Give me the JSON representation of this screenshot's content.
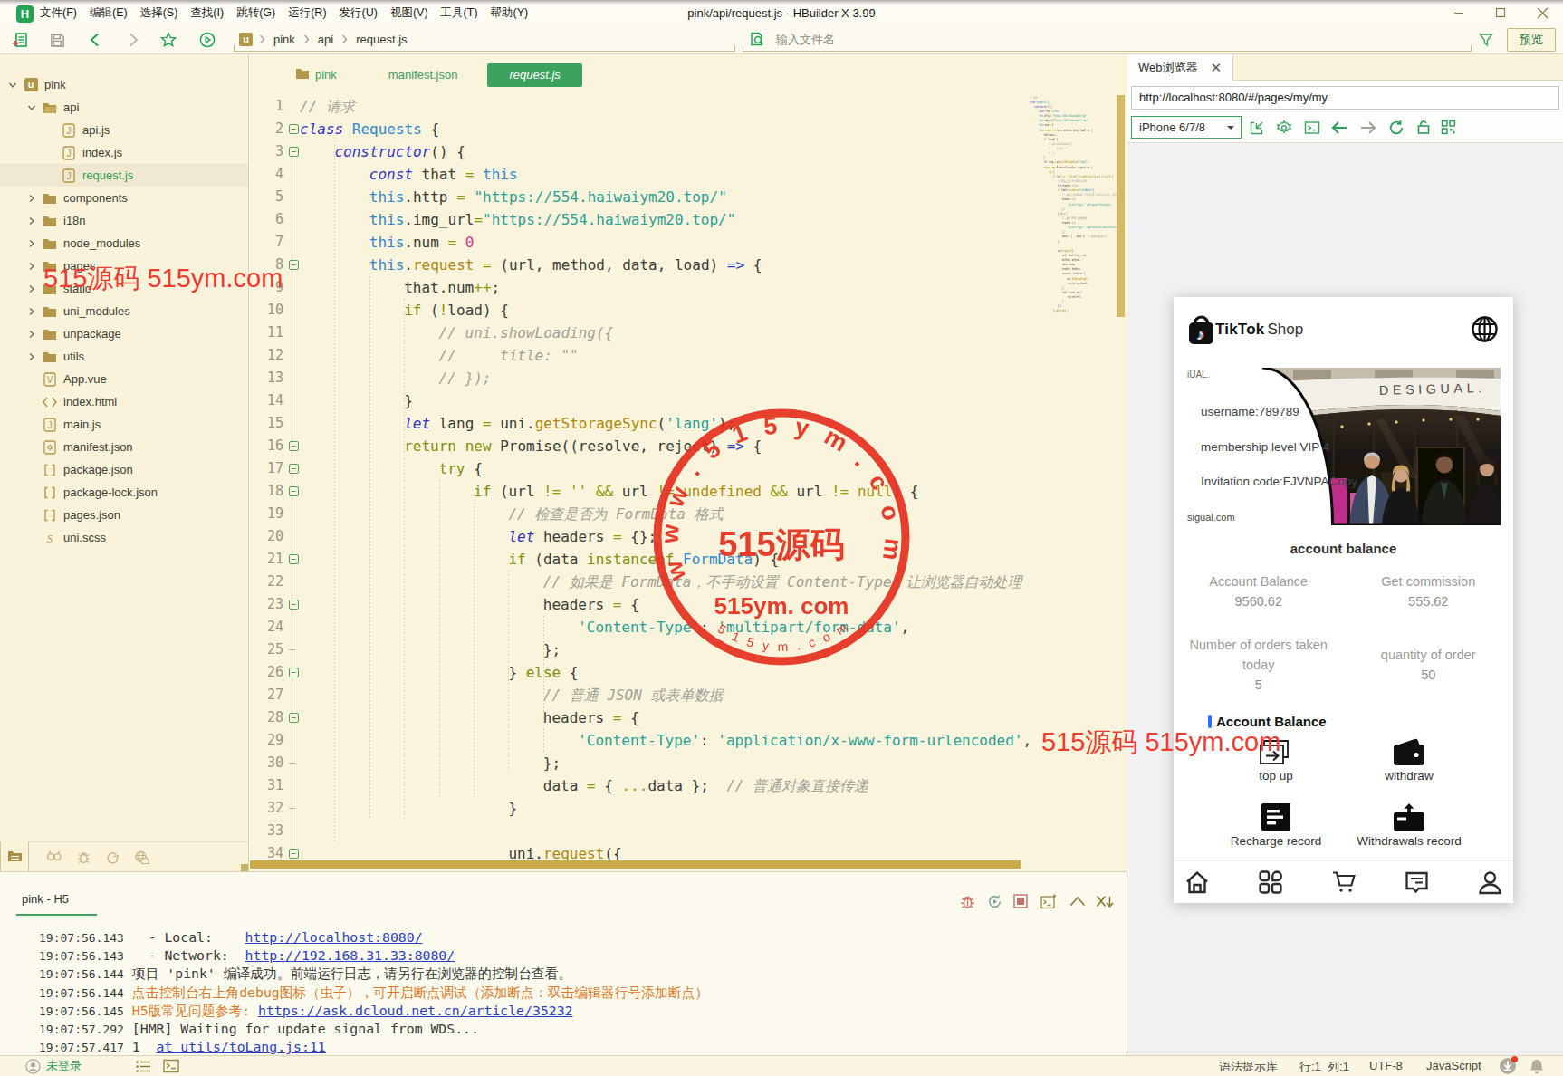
{
  "window": {
    "title": "pink/api/request.js - HBuilder X 3.99",
    "logo_letter": "H",
    "menus": [
      "文件(F)",
      "编辑(E)",
      "选择(S)",
      "查找(I)",
      "跳转(G)",
      "运行(R)",
      "发行(U)",
      "视图(V)",
      "工具(T)",
      "帮助(Y)"
    ]
  },
  "toolbar": {
    "breadcrumb": [
      "pink",
      "api",
      "request.js"
    ],
    "breadcrumb_icon": "u",
    "search_placeholder": "输入文件名",
    "preview_label": "预览"
  },
  "sidebar": {
    "tree": [
      {
        "label": "pink",
        "depth": 0,
        "kind": "project",
        "chev": "down"
      },
      {
        "label": "api",
        "depth": 1,
        "kind": "folder-open",
        "chev": "down"
      },
      {
        "label": "api.js",
        "depth": 2,
        "kind": "js"
      },
      {
        "label": "index.js",
        "depth": 2,
        "kind": "js"
      },
      {
        "label": "request.js",
        "depth": 2,
        "kind": "js",
        "selected": true
      },
      {
        "label": "components",
        "depth": 1,
        "kind": "folder",
        "chev": "right"
      },
      {
        "label": "i18n",
        "depth": 1,
        "kind": "folder",
        "chev": "right"
      },
      {
        "label": "node_modules",
        "depth": 1,
        "kind": "folder",
        "chev": "right"
      },
      {
        "label": "pages",
        "depth": 1,
        "kind": "folder",
        "chev": "right"
      },
      {
        "label": "static",
        "depth": 1,
        "kind": "folder",
        "chev": "right"
      },
      {
        "label": "uni_modules",
        "depth": 1,
        "kind": "folder",
        "chev": "right"
      },
      {
        "label": "unpackage",
        "depth": 1,
        "kind": "folder",
        "chev": "right"
      },
      {
        "label": "utils",
        "depth": 1,
        "kind": "folder",
        "chev": "right"
      },
      {
        "label": "App.vue",
        "depth": 1,
        "kind": "vue"
      },
      {
        "label": "index.html",
        "depth": 1,
        "kind": "html"
      },
      {
        "label": "main.js",
        "depth": 1,
        "kind": "js"
      },
      {
        "label": "manifest.json",
        "depth": 1,
        "kind": "json-gear"
      },
      {
        "label": "package.json",
        "depth": 1,
        "kind": "json-br"
      },
      {
        "label": "package-lock.json",
        "depth": 1,
        "kind": "json-br"
      },
      {
        "label": "pages.json",
        "depth": 1,
        "kind": "json-br"
      },
      {
        "label": "uni.scss",
        "depth": 1,
        "kind": "scss"
      }
    ]
  },
  "editor": {
    "tabs": [
      {
        "label": "pink",
        "icon": "folder",
        "active": false
      },
      {
        "label": "manifest.json",
        "active": false
      },
      {
        "label": "request.js",
        "active": true
      }
    ],
    "fold_lines": [
      2,
      3,
      8,
      16,
      17,
      18,
      21,
      23,
      26,
      28,
      34
    ],
    "fold_end_lines": [
      25,
      30,
      32
    ],
    "code_lines": [
      {
        "n": 1,
        "ind": 0,
        "t": [
          [
            "cm",
            "// 请求"
          ]
        ]
      },
      {
        "n": 2,
        "ind": 0,
        "t": [
          [
            "kw",
            "class"
          ],
          [
            "pl",
            " "
          ],
          [
            "az",
            "Requests"
          ],
          [
            "pl",
            " {"
          ]
        ]
      },
      {
        "n": 3,
        "ind": 4,
        "t": [
          [
            "kw",
            "constructor"
          ],
          [
            "pl",
            "() {"
          ]
        ]
      },
      {
        "n": 4,
        "ind": 8,
        "t": [
          [
            "kw",
            "const"
          ],
          [
            "pl",
            " that "
          ],
          [
            "op",
            "="
          ],
          [
            "pl",
            " "
          ],
          [
            "az",
            "this"
          ]
        ]
      },
      {
        "n": 5,
        "ind": 8,
        "t": [
          [
            "az",
            "this"
          ],
          [
            "pl",
            ".http "
          ],
          [
            "op",
            "="
          ],
          [
            "pl",
            " "
          ],
          [
            "st",
            "\"https://554.haiwaiym20.top/\""
          ]
        ]
      },
      {
        "n": 6,
        "ind": 8,
        "t": [
          [
            "az",
            "this"
          ],
          [
            "pl",
            ".img_url"
          ],
          [
            "op",
            "="
          ],
          [
            "st",
            "\"https://554.haiwaiym20.top/\""
          ]
        ]
      },
      {
        "n": 7,
        "ind": 8,
        "t": [
          [
            "az",
            "this"
          ],
          [
            "pl",
            ".num "
          ],
          [
            "op",
            "="
          ],
          [
            "pl",
            " "
          ],
          [
            "nu",
            "0"
          ]
        ]
      },
      {
        "n": 8,
        "ind": 8,
        "t": [
          [
            "az",
            "this"
          ],
          [
            "pl",
            "."
          ],
          [
            "pr",
            "request"
          ],
          [
            "pl",
            " "
          ],
          [
            "op",
            "="
          ],
          [
            "pl",
            " (url, method, data, load) "
          ],
          [
            "ar",
            "=>"
          ],
          [
            "pl",
            " {"
          ]
        ]
      },
      {
        "n": 9,
        "ind": 12,
        "t": [
          [
            "pl",
            "that.num"
          ],
          [
            "op",
            "++"
          ],
          [
            "pl",
            ";"
          ]
        ]
      },
      {
        "n": 10,
        "ind": 12,
        "t": [
          [
            "ct",
            "if"
          ],
          [
            "pl",
            " ("
          ],
          [
            "op",
            "!"
          ],
          [
            "pl",
            "load) {"
          ]
        ]
      },
      {
        "n": 11,
        "ind": 16,
        "t": [
          [
            "cm",
            "// uni.showLoading({"
          ]
        ]
      },
      {
        "n": 12,
        "ind": 16,
        "t": [
          [
            "cm",
            "//     title: \"\""
          ]
        ]
      },
      {
        "n": 13,
        "ind": 16,
        "t": [
          [
            "cm",
            "// });"
          ]
        ]
      },
      {
        "n": 14,
        "ind": 12,
        "t": [
          [
            "pl",
            "}"
          ]
        ]
      },
      {
        "n": 15,
        "ind": 12,
        "t": [
          [
            "kw",
            "let"
          ],
          [
            "pl",
            " lang "
          ],
          [
            "op",
            "="
          ],
          [
            "pl",
            " uni."
          ],
          [
            "pr",
            "getStorageSync"
          ],
          [
            "pl",
            "("
          ],
          [
            "st",
            "'lang'"
          ],
          [
            "pl",
            ");"
          ]
        ]
      },
      {
        "n": 16,
        "ind": 12,
        "t": [
          [
            "ct",
            "return"
          ],
          [
            "pl",
            " "
          ],
          [
            "ct",
            "new"
          ],
          [
            "pl",
            " Promise((resolve, reject) "
          ],
          [
            "ar",
            "=>"
          ],
          [
            "pl",
            " {"
          ]
        ]
      },
      {
        "n": 17,
        "ind": 16,
        "t": [
          [
            "ct",
            "try"
          ],
          [
            "pl",
            " {"
          ]
        ]
      },
      {
        "n": 18,
        "ind": 20,
        "t": [
          [
            "ct",
            "if"
          ],
          [
            "pl",
            " (url "
          ],
          [
            "op",
            "!="
          ],
          [
            "pl",
            " "
          ],
          [
            "op",
            "''"
          ],
          [
            "pl",
            " "
          ],
          [
            "op",
            "&&"
          ],
          [
            "pl",
            " url "
          ],
          [
            "op",
            "!="
          ],
          [
            "pl",
            " "
          ],
          [
            "gd",
            "undefined"
          ],
          [
            "pl",
            " "
          ],
          [
            "op",
            "&&"
          ],
          [
            "pl",
            " url "
          ],
          [
            "op",
            "!="
          ],
          [
            "pl",
            " "
          ],
          [
            "gd",
            "null"
          ],
          [
            "pl",
            ") {"
          ]
        ]
      },
      {
        "n": 19,
        "ind": 24,
        "t": [
          [
            "cm",
            "// 检查是否为 FormData 格式"
          ]
        ]
      },
      {
        "n": 20,
        "ind": 24,
        "t": [
          [
            "kw",
            "let"
          ],
          [
            "pl",
            " headers "
          ],
          [
            "op",
            "="
          ],
          [
            "pl",
            " {};"
          ]
        ]
      },
      {
        "n": 21,
        "ind": 24,
        "t": [
          [
            "ct",
            "if"
          ],
          [
            "pl",
            " (data "
          ],
          [
            "ct",
            "instanceof"
          ],
          [
            "pl",
            " "
          ],
          [
            "az",
            "FormData"
          ],
          [
            "pl",
            ") {"
          ]
        ]
      },
      {
        "n": 22,
        "ind": 28,
        "t": [
          [
            "cm",
            "// 如果是 FormData，不手动设置 Content-Type，让浏览器自动处理"
          ]
        ]
      },
      {
        "n": 23,
        "ind": 28,
        "t": [
          [
            "pl",
            "headers "
          ],
          [
            "op",
            "="
          ],
          [
            "pl",
            " {"
          ]
        ]
      },
      {
        "n": 24,
        "ind": 32,
        "t": [
          [
            "st",
            "'Content-Type'"
          ],
          [
            "pl",
            ": "
          ],
          [
            "st",
            "'multipart/form-data'"
          ],
          [
            "pl",
            ","
          ]
        ]
      },
      {
        "n": 25,
        "ind": 28,
        "t": [
          [
            "pl",
            "};"
          ]
        ]
      },
      {
        "n": 26,
        "ind": 24,
        "t": [
          [
            "pl",
            "} "
          ],
          [
            "ct",
            "else"
          ],
          [
            "pl",
            " {"
          ]
        ]
      },
      {
        "n": 27,
        "ind": 28,
        "t": [
          [
            "cm",
            "// 普通 JSON 或表单数据"
          ]
        ]
      },
      {
        "n": 28,
        "ind": 28,
        "t": [
          [
            "pl",
            "headers "
          ],
          [
            "op",
            "="
          ],
          [
            "pl",
            " {"
          ]
        ]
      },
      {
        "n": 29,
        "ind": 32,
        "t": [
          [
            "st",
            "'Content-Type'"
          ],
          [
            "pl",
            ": "
          ],
          [
            "st",
            "'application/x-www-form-urlencoded'"
          ],
          [
            "pl",
            ","
          ]
        ]
      },
      {
        "n": 30,
        "ind": 28,
        "t": [
          [
            "pl",
            "};"
          ]
        ]
      },
      {
        "n": 31,
        "ind": 28,
        "t": [
          [
            "pl",
            "data "
          ],
          [
            "op",
            "="
          ],
          [
            "pl",
            " { "
          ],
          [
            "gd",
            "..."
          ],
          [
            "pl",
            "data };  "
          ],
          [
            "cm",
            "// 普通对象直接传递"
          ]
        ]
      },
      {
        "n": 32,
        "ind": 24,
        "t": [
          [
            "pl",
            "}"
          ]
        ]
      },
      {
        "n": 33,
        "ind": 0,
        "t": []
      },
      {
        "n": 34,
        "ind": 24,
        "t": [
          [
            "pl",
            "uni."
          ],
          [
            "pr",
            "request"
          ],
          [
            "pl",
            "({"
          ]
        ]
      }
    ],
    "minimap_extra": [
      {
        "ind": 28,
        "t": [
          [
            "pl",
            "url: that.http "
          ],
          [
            "op",
            "+"
          ],
          [
            "pl",
            " url,"
          ]
        ]
      },
      {
        "ind": 28,
        "t": [
          [
            "pl",
            "method: method,"
          ]
        ]
      },
      {
        "ind": 28,
        "t": [
          [
            "pl",
            "data: data,"
          ]
        ]
      },
      {
        "ind": 28,
        "t": [
          [
            "pl",
            "header: headers,"
          ]
        ]
      },
      {
        "ind": 28,
        "t": [
          [
            "pl",
            "success: (res) "
          ],
          [
            "ar",
            "=>"
          ],
          [
            "pl",
            " {"
          ]
        ]
      },
      {
        "ind": 32,
        "t": [
          [
            "pl",
            "uni."
          ],
          [
            "pr",
            "hideLoading"
          ],
          [
            "pl",
            "();"
          ]
        ]
      },
      {
        "ind": 32,
        "t": [
          [
            "pl",
            "resolve(res.data);"
          ]
        ]
      },
      {
        "ind": 28,
        "t": [
          [
            "pl",
            "},"
          ]
        ]
      },
      {
        "ind": 28,
        "t": [
          [
            "pl",
            "fail: (err) "
          ],
          [
            "ar",
            "=>"
          ],
          [
            "pl",
            " {"
          ]
        ]
      },
      {
        "ind": 32,
        "t": [
          [
            "pl",
            "reject(err);"
          ]
        ]
      },
      {
        "ind": 28,
        "t": [
          [
            "pl",
            "}"
          ]
        ]
      },
      {
        "ind": 24,
        "t": [
          [
            "pl",
            "});"
          ]
        ]
      },
      {
        "ind": 20,
        "t": [
          [
            "pl",
            "} "
          ],
          [
            "ct",
            "catch"
          ],
          [
            "pl",
            " (e) {"
          ]
        ]
      }
    ]
  },
  "webview": {
    "tab_label": "Web浏览器",
    "url": "http://localhost:8080/#/pages/my/my",
    "device": "iPhone 6/7/8",
    "phone": {
      "brand_bold": "TikTok",
      "brand_light": "Shop",
      "banner_sign": "DESIGUAL.",
      "banner_corner_top": "iUAL.",
      "banner_corner_bottom": "sigual.com",
      "banner_line1": "username:789789",
      "banner_line2": "membership level VIP 4",
      "banner_line3": "Invitation code:FJVNPACopy",
      "section_title": "account balance",
      "stats": [
        {
          "label": "Account Balance",
          "value": "9560.62"
        },
        {
          "label": "Get commission",
          "value": "555.62"
        },
        {
          "label": "Number of orders taken today",
          "value": "5"
        },
        {
          "label": "quantity of order",
          "value": "50"
        }
      ],
      "balance_header": "Account Balance",
      "actions": [
        {
          "label": "top up",
          "icon": "card-arrow"
        },
        {
          "label": "withdraw",
          "icon": "wallet"
        },
        {
          "label": "Recharge record",
          "icon": "doc-lines"
        },
        {
          "label": "Withdrawals record",
          "icon": "card-up"
        }
      ]
    }
  },
  "console": {
    "tab_label": "pink - H5",
    "logs": [
      [
        [
          "t",
          "19:07:56.143"
        ],
        [
          "p",
          "   - Local:    "
        ],
        [
          "link",
          "http://localhost:8080/"
        ]
      ],
      [
        [
          "t",
          "19:07:56.143"
        ],
        [
          "p",
          "   - Network:  "
        ],
        [
          "link",
          "http://192.168.31.33:8080/"
        ]
      ],
      [
        [
          "t",
          "19:07:56.144"
        ],
        [
          "p",
          " 项目 'pink' 编译成功。前端运行日志，请另行在浏览器的控制台查看。"
        ]
      ],
      [
        [
          "t",
          "19:07:56.144"
        ],
        [
          "o",
          " 点击控制台右上角debug图标（虫子），可开启断点调试（添加断点：双击编辑器行号添加断点）"
        ]
      ],
      [
        [
          "t",
          "19:07:56.145"
        ],
        [
          "o",
          " H5版常见问题参考: "
        ],
        [
          "link",
          "https://ask.dcloud.net.cn/article/35232"
        ]
      ],
      [
        [
          "t",
          "19:07:57.292"
        ],
        [
          "p",
          " [HMR] Waiting for update signal from WDS..."
        ]
      ],
      [
        [
          "t",
          "19:07:57.417"
        ],
        [
          "p",
          " 1  "
        ],
        [
          "link",
          "at utils/toLang.js:11"
        ]
      ]
    ]
  },
  "statusbar": {
    "login": "未登录",
    "right_items": [
      "语法提示库",
      "行:1  列:1",
      "UTF-8",
      "JavaScript"
    ]
  },
  "watermarks": {
    "text": "515源码 515ym.com",
    "stamp_arc_top": "w w w . 5 1 5 y m . c o m",
    "stamp_center": "515源码",
    "stamp_sub": "515ym. com",
    "stamp_arc_bottom": "5 1 5 y m . c o m",
    "color": "#f13b30"
  }
}
